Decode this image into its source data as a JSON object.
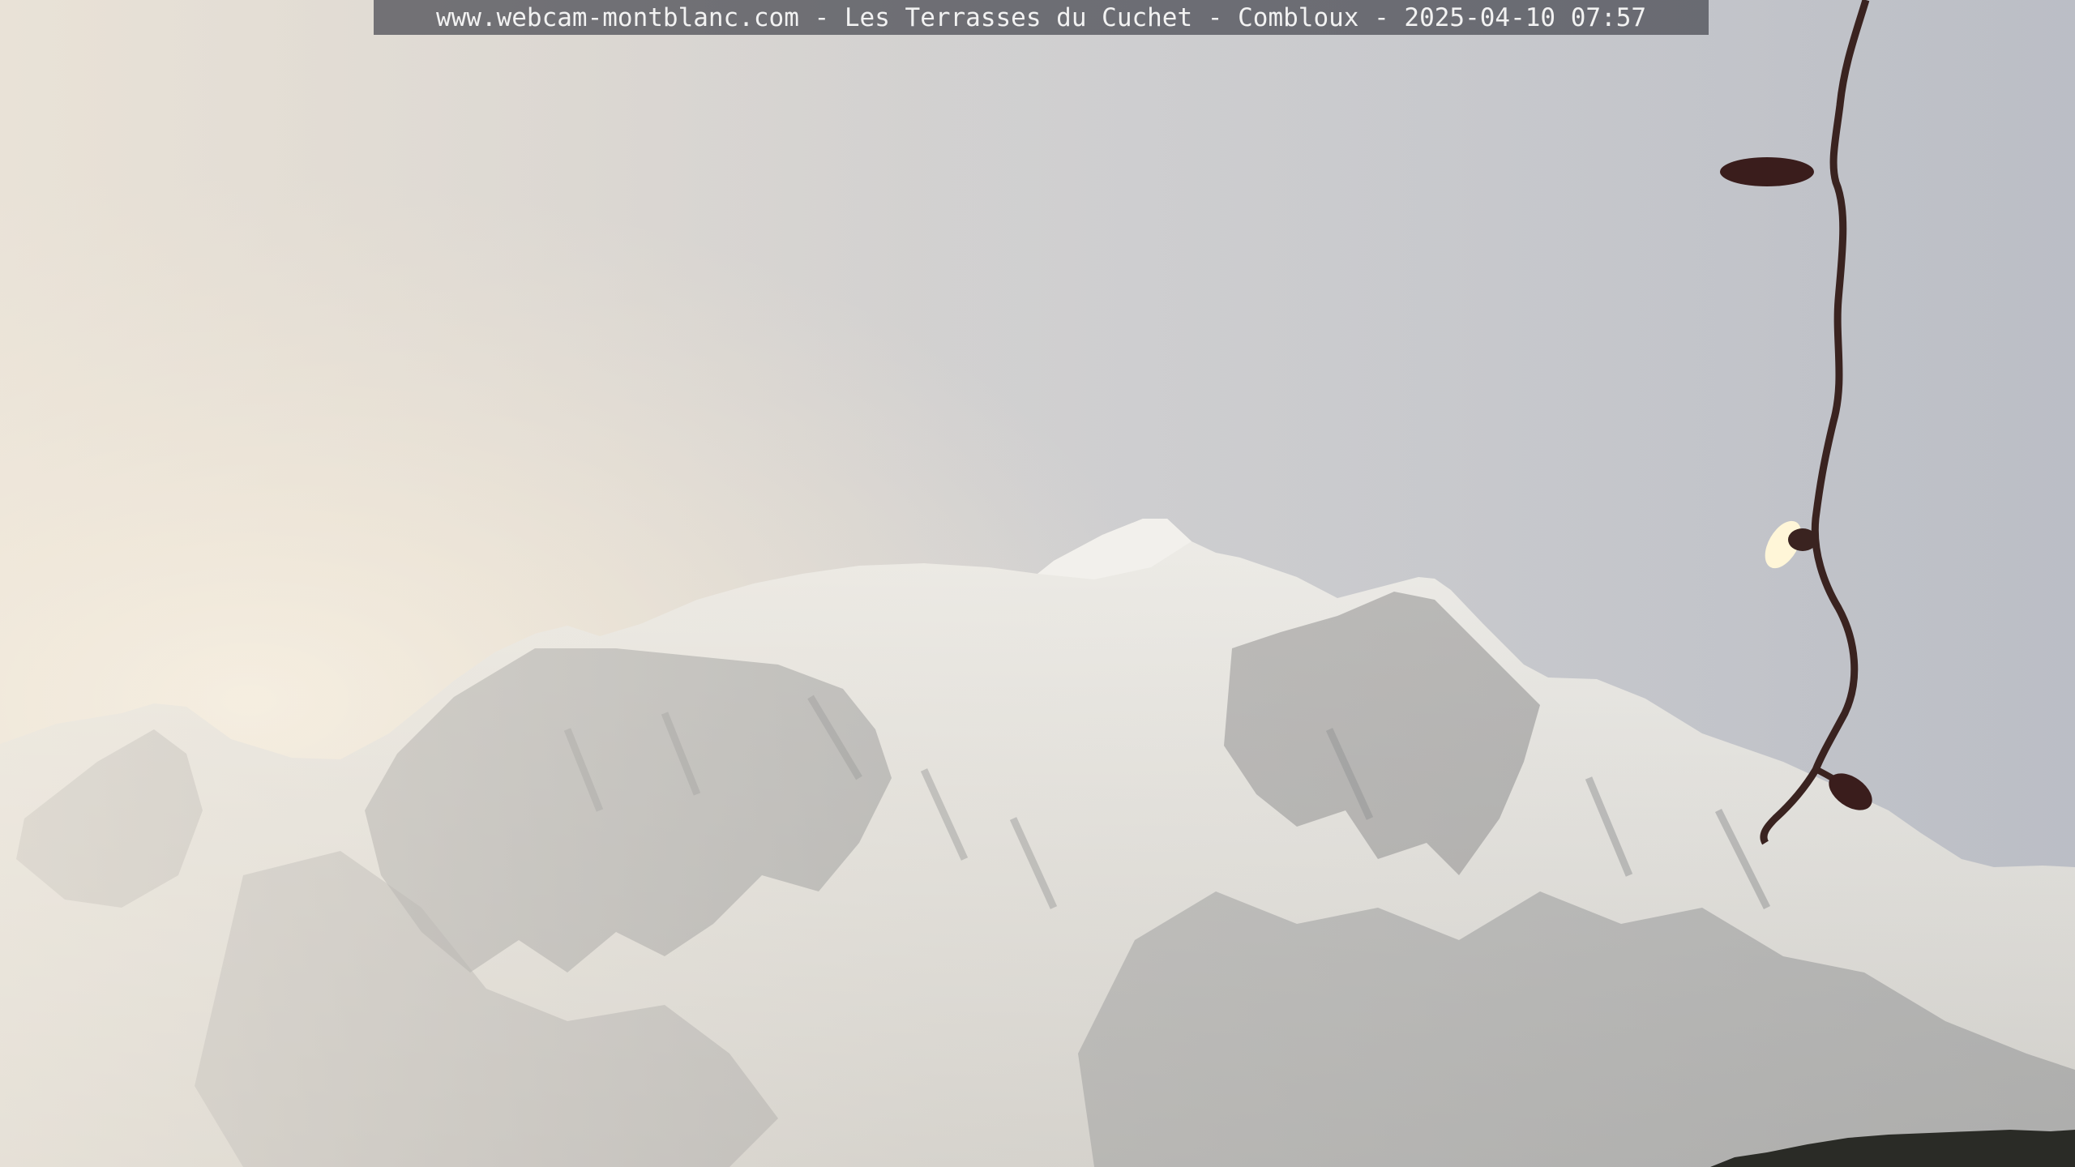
{
  "overlay": {
    "caption": "www.webcam-montblanc.com - Les Terrasses du Cuchet - Combloux - 2025-04-10 07:57"
  },
  "colors": {
    "sky_top": "#c3c6cd",
    "sky_glow": "#f4ead8",
    "snow": "#e6e5e2",
    "rock": "#8d8e8f",
    "cable": "#3a2320",
    "bulb_lit": "#fff6d8",
    "caption_bg": "#46484f"
  }
}
